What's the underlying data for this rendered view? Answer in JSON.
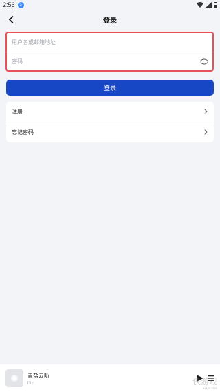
{
  "status_bar": {
    "time": "2:56",
    "app_badge": "a"
  },
  "nav": {
    "title": "登录"
  },
  "form": {
    "username_placeholder": "用户名或邮箱地址",
    "username_value": "",
    "password_placeholder": "密码",
    "password_value": ""
  },
  "login_button": {
    "label": "登录"
  },
  "menu": {
    "items": [
      {
        "label": "注册"
      },
      {
        "label": "忘记密码"
      }
    ]
  },
  "player": {
    "title": "青盐云听",
    "subtitle": "Hi~"
  },
  "watermark": {
    "text": "侠游戏",
    "sub": "xiayx.com"
  },
  "colors": {
    "accent": "#1747c4",
    "highlight_border": "#e8505b",
    "background": "#f3f4f8"
  },
  "icons": {
    "back": "chevron-left-icon",
    "password_toggle": "eye-toggle-icon",
    "menu_arrow": "chevron-right-icon",
    "play": "play-icon",
    "playlist": "playlist-icon"
  }
}
